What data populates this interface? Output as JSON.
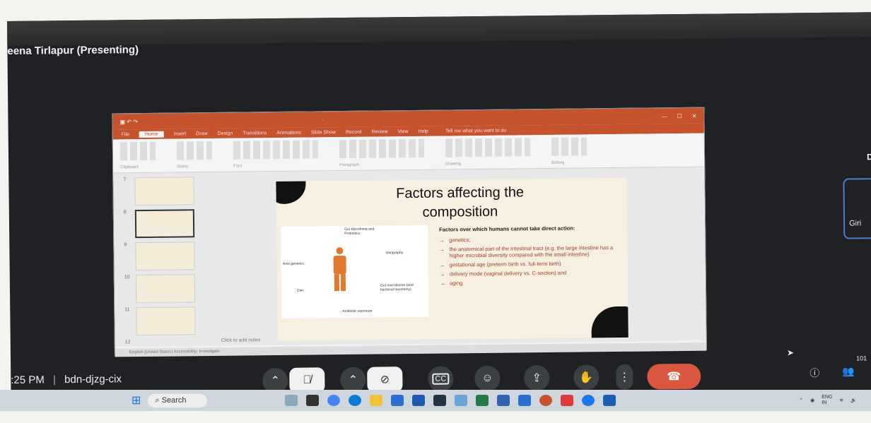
{
  "meeting": {
    "presenter": "eena Tirlapur (Presenting)",
    "time": ":25 PM",
    "separator": "|",
    "meeting_code": "bdn-djzg-cix",
    "participant_count": "101",
    "side_tile_name": "Giri",
    "side_tile_initial": "D"
  },
  "powerpoint": {
    "menu_tabs": [
      "File",
      "Home",
      "Insert",
      "Draw",
      "Design",
      "Transitions",
      "Animations",
      "Slide Show",
      "Record",
      "Review",
      "View",
      "Help"
    ],
    "active_tab": "Home",
    "tell_me": "Tell me what you want to do",
    "ribbon_groups": [
      "Clipboard",
      "Slides",
      "Font",
      "Paragraph",
      "Drawing",
      "Editing"
    ],
    "slide_numbers": [
      "7",
      "8",
      "9",
      "10",
      "11",
      "12"
    ],
    "notes_placeholder": "Click to add notes",
    "status": "English (United States)   Accessibility: Investigate"
  },
  "slide": {
    "title_line1": "Factors affecting the",
    "title_line2": "composition",
    "intro": "Factors over which humans cannot take direct action:",
    "bullets": [
      "genetics;",
      "the anatomical part of the intestinal tract (e.g. the large intestine has a higher microbial diversity compared with the small intestine)",
      "gestational age (preterm birth vs. full-term birth)",
      "delivery mode (vaginal delivery vs. C-section) and",
      "aging"
    ],
    "diagram_labels": {
      "top": "Gut Microbiota and Probiotics",
      "right": "Geography",
      "left": "Host genetics",
      "bottom_left": "Diet",
      "bottom_right": "Gut microbiome (and bacterial taxonomy)",
      "bottom": "Antibiotic exposure"
    }
  },
  "taskbar": {
    "search_label": "Search",
    "lang": "ENG",
    "region": "IN"
  },
  "colors": {
    "ppt_accent": "#c4532e",
    "end_call": "#d9573e",
    "tile_border": "#4a7fd4"
  }
}
